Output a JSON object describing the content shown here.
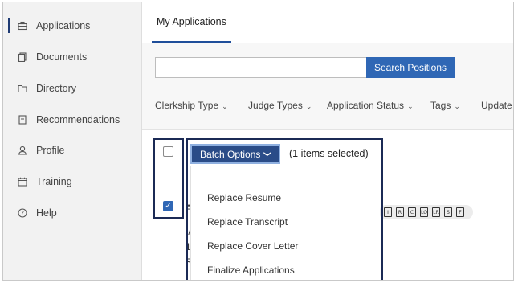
{
  "sidebar": {
    "items": [
      {
        "label": "Applications",
        "icon": "briefcase-icon",
        "active": true
      },
      {
        "label": "Documents",
        "icon": "document-icon"
      },
      {
        "label": "Directory",
        "icon": "folder-icon"
      },
      {
        "label": "Recommendations",
        "icon": "recommendation-icon"
      },
      {
        "label": "Profile",
        "icon": "person-icon"
      },
      {
        "label": "Training",
        "icon": "calendar-icon"
      },
      {
        "label": "Help",
        "icon": "help-icon"
      }
    ]
  },
  "main": {
    "tab": "My Applications",
    "search": {
      "placeholder": "",
      "button": "Search Positions"
    },
    "filters": [
      "Clerkship Type",
      "Judge Types",
      "Application Status",
      "Tags",
      "Update"
    ],
    "batch": {
      "button": "Batch Options",
      "selected": "(1 items selected)",
      "menu": [
        "Replace Resume",
        "Replace Transcript",
        "Replace Cover Letter",
        "Finalize Applications"
      ]
    },
    "row_fragments": [
      "A",
      "I/",
      "1",
      "S"
    ],
    "doc_icons": [
      "I",
      "R",
      "C",
      "LO",
      "LR",
      "S",
      "F"
    ]
  },
  "colors": {
    "accent": "#2f67b5",
    "batch": "#2a4c88",
    "highlight": "#1b2a55",
    "sidebar_bg": "#f2f2f2"
  }
}
